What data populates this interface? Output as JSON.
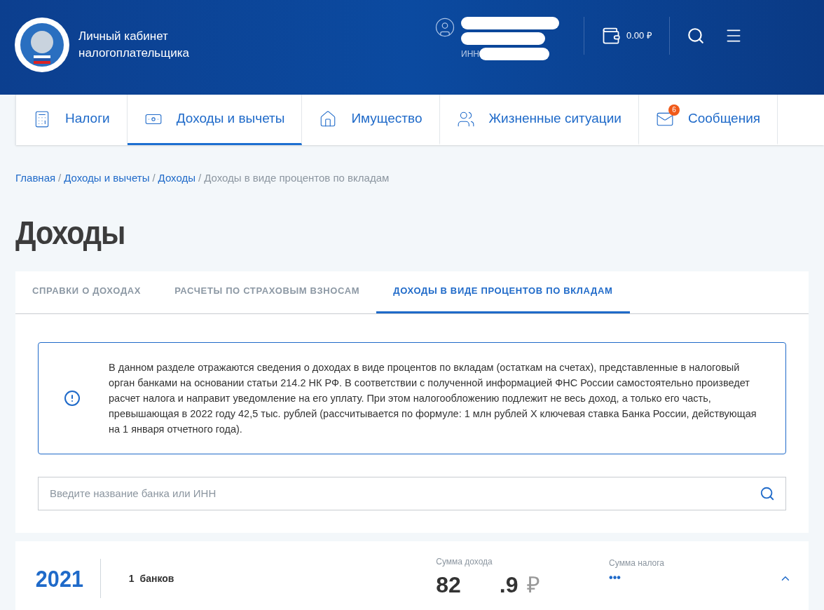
{
  "header": {
    "title_line_1": "Личный кабинет",
    "title_line_2": "налогоплательщика",
    "inn_label": "ИНН",
    "balance": "0.00 ₽"
  },
  "nav": [
    {
      "label": "Налоги",
      "selected": false,
      "kind": "calculator"
    },
    {
      "label": "Доходы и вычеты",
      "selected": true,
      "kind": "money"
    },
    {
      "label": "Имущество",
      "selected": false,
      "kind": "house"
    },
    {
      "label": "Жизненные ситуации",
      "selected": false,
      "kind": "person"
    },
    {
      "label": "Сообщения",
      "selected": false,
      "kind": "mail",
      "badge": "6"
    }
  ],
  "breadcrumb_separator": "/",
  "breadcrumbs": [
    {
      "label": "Главная",
      "link": true
    },
    {
      "label": "Доходы и вычеты",
      "link": true
    },
    {
      "label": "Доходы",
      "link": true
    },
    {
      "label": "Доходы в виде процентов по вкладам",
      "link": false
    }
  ],
  "page_title": "Доходы",
  "tabs": [
    {
      "label": "СПРАВКИ О ДОХОДАХ",
      "selected": false
    },
    {
      "label": "РАСЧЕТЫ ПО СТРАХОВЫМ ВЗНОСАМ",
      "selected": false
    },
    {
      "label": "ДОХОДЫ В ВИДЕ ПРОЦЕНТОВ ПО ВКЛАДАМ",
      "selected": true
    }
  ],
  "info": "В данном разделе отражаются сведения о доходах в виде процентов по вкладам (остаткам на счетах), представленные в налоговый орган банками на основании статьи 214.2 НК РФ. В соответствии с полученной информацией ФНС России самостоятельно произведет расчет налога и направит уведомление на его уплату. При этом налогообложению подлежит не весь доход, а только его часть, превышающая в 2022 году 42,5 тыс. рублей (рассчитывается по формуле: 1 млн рублей Х ключевая ставка Банка России, действующая на 1 января отчетного года).",
  "search": {
    "placeholder": "Введите название банка или ИНН"
  },
  "years": [
    {
      "year": "2021",
      "banks_prefix": "1",
      "banks_suffix": "банков",
      "income_label": "Сумма дохода",
      "income_start": "82",
      "income_end": ".9",
      "currency": "₽",
      "tax_label": "Сумма налога",
      "tax_value": "•••",
      "expanded": true
    }
  ]
}
